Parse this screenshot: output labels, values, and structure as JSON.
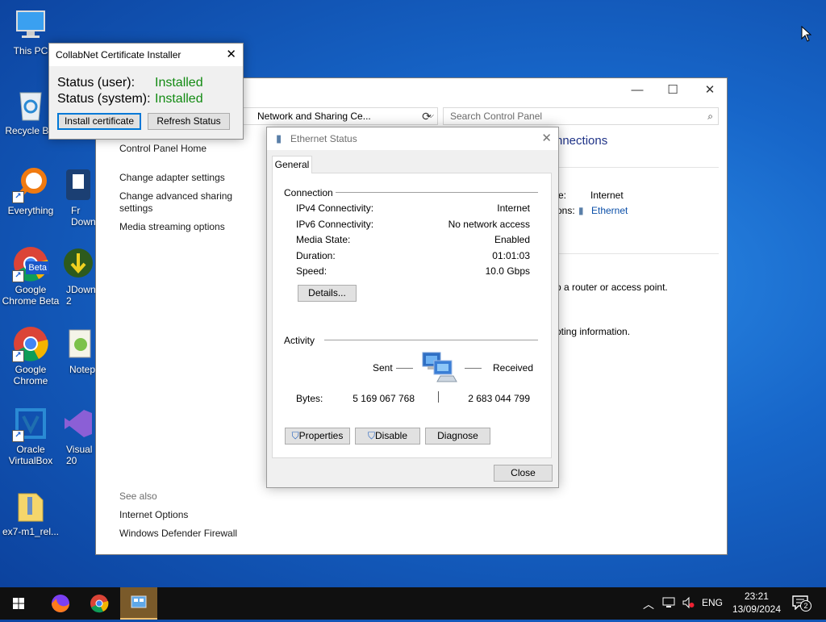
{
  "desktop": {
    "icons": [
      {
        "label": "This PC"
      },
      {
        "label": "Recycle Bin"
      },
      {
        "label": "Everything"
      },
      {
        "label": "Google Chrome Beta",
        "badge": "Beta"
      },
      {
        "label": "Google Chrome"
      },
      {
        "label": "Oracle VirtualBox"
      },
      {
        "label": "ex7-m1_rel..."
      },
      {
        "label": "Fr Down"
      },
      {
        "label": "JDown 2"
      },
      {
        "label": "Notep"
      },
      {
        "label": "Visual 20"
      }
    ]
  },
  "control_panel": {
    "address": "Network and Sharing Ce...",
    "search_placeholder": "Search Control Panel",
    "heading_fragment": "nnections",
    "nav": [
      "Control Panel Home",
      "Change adapter settings",
      "Change advanced sharing settings",
      "Media streaming options"
    ],
    "see_also": "See also",
    "see_also_links": [
      "Internet Options",
      "Windows Defender Firewall"
    ],
    "access_type_label": "e:",
    "access_type_value": "Internet",
    "connections_label": "ons:",
    "connections_value": "Ethernet",
    "text_router": "p a router or access point.",
    "text_troubleshoot": "oting information."
  },
  "collabnet": {
    "title": "CollabNet Certificate Installer",
    "status_user_label": "Status (user):",
    "status_user_value": "Installed",
    "status_system_label": "Status (system):",
    "status_system_value": "Installed",
    "install_button": "Install certificate",
    "refresh_button": "Refresh Status",
    "status_color": "#128a12"
  },
  "ethernet": {
    "title": "Ethernet Status",
    "tab": "General",
    "connection_group": "Connection",
    "rows": [
      {
        "label": "IPv4 Connectivity:",
        "value": "Internet"
      },
      {
        "label": "IPv6 Connectivity:",
        "value": "No network access"
      },
      {
        "label": "Media State:",
        "value": "Enabled"
      },
      {
        "label": "Duration:",
        "value": "01:01:03"
      },
      {
        "label": "Speed:",
        "value": "10.0 Gbps"
      }
    ],
    "details_button": "Details...",
    "activity_group": "Activity",
    "sent_label": "Sent",
    "received_label": "Received",
    "bytes_label": "Bytes:",
    "bytes_sent": "5 169 067 768",
    "bytes_received": "2 683 044 799",
    "properties_button": "Properties",
    "disable_button": "Disable",
    "diagnose_button": "Diagnose",
    "close_button": "Close"
  },
  "taskbar": {
    "language": "ENG",
    "time": "23:21",
    "date": "13/09/2024",
    "notification_count": "2"
  }
}
